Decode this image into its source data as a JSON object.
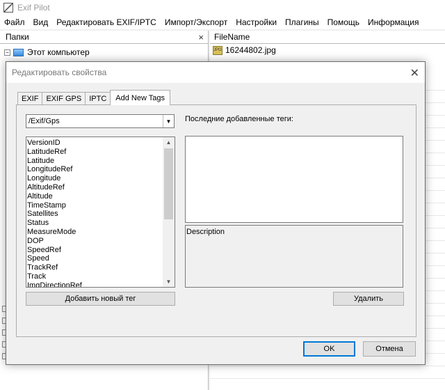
{
  "app": {
    "title": "Exif Pilot",
    "menu": [
      "Файл",
      "Вид",
      "Редактировать EXIF/IPTC",
      "Импорт/Экспорт",
      "Настройки",
      "Плагины",
      "Помощь",
      "Информация"
    ]
  },
  "folders_pane": {
    "header": "Папки",
    "close_glyph": "×",
    "tree_root": "Этот компьютер",
    "expander_glyph": "−"
  },
  "files_pane": {
    "header": "FileName",
    "files": [
      {
        "name": "16244802.jpg"
      }
    ]
  },
  "dialog": {
    "title": "Редактировать свойства",
    "close_glyph": "✕",
    "tabs": [
      "EXIF",
      "EXIF GPS",
      "IPTC",
      "Add New Tags"
    ],
    "active_tab": "Add New Tags",
    "path_combo": {
      "value": "/Exif/Gps"
    },
    "recent_tags_label": "Последние добавленные теги:",
    "tags": [
      "VersionID",
      "LatitudeRef",
      "Latitude",
      "LongitudeRef",
      "Longitude",
      "AltitudeRef",
      "Altitude",
      "TimeStamp",
      "Satellites",
      "Status",
      "MeasureMode",
      "DOP",
      "SpeedRef",
      "Speed",
      "TrackRef",
      "Track",
      "ImgDirectionRef"
    ],
    "description_label": "Description",
    "add_tag_button": "Добавить новый тег",
    "delete_button": "Удалить",
    "ok_button": "OK",
    "cancel_button": "Отмена"
  }
}
